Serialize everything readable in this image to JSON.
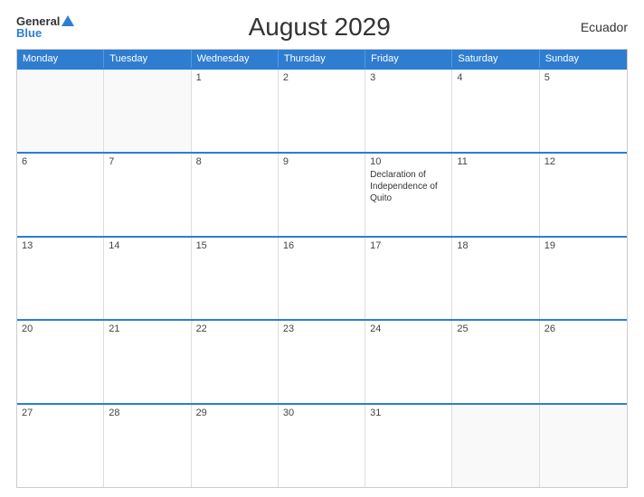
{
  "header": {
    "logo_general": "General",
    "logo_blue": "Blue",
    "title": "August 2029",
    "country": "Ecuador"
  },
  "days_of_week": [
    "Monday",
    "Tuesday",
    "Wednesday",
    "Thursday",
    "Friday",
    "Saturday",
    "Sunday"
  ],
  "weeks": [
    [
      {
        "num": "",
        "empty": true
      },
      {
        "num": "",
        "empty": true
      },
      {
        "num": "1",
        "empty": false
      },
      {
        "num": "2",
        "empty": false
      },
      {
        "num": "3",
        "empty": false
      },
      {
        "num": "4",
        "empty": false
      },
      {
        "num": "5",
        "empty": false
      }
    ],
    [
      {
        "num": "6",
        "empty": false
      },
      {
        "num": "7",
        "empty": false
      },
      {
        "num": "8",
        "empty": false
      },
      {
        "num": "9",
        "empty": false
      },
      {
        "num": "10",
        "empty": false,
        "event": "Declaration of Independence of Quito"
      },
      {
        "num": "11",
        "empty": false
      },
      {
        "num": "12",
        "empty": false
      }
    ],
    [
      {
        "num": "13",
        "empty": false
      },
      {
        "num": "14",
        "empty": false
      },
      {
        "num": "15",
        "empty": false
      },
      {
        "num": "16",
        "empty": false
      },
      {
        "num": "17",
        "empty": false
      },
      {
        "num": "18",
        "empty": false
      },
      {
        "num": "19",
        "empty": false
      }
    ],
    [
      {
        "num": "20",
        "empty": false
      },
      {
        "num": "21",
        "empty": false
      },
      {
        "num": "22",
        "empty": false
      },
      {
        "num": "23",
        "empty": false
      },
      {
        "num": "24",
        "empty": false
      },
      {
        "num": "25",
        "empty": false
      },
      {
        "num": "26",
        "empty": false
      }
    ],
    [
      {
        "num": "27",
        "empty": false
      },
      {
        "num": "28",
        "empty": false
      },
      {
        "num": "29",
        "empty": false
      },
      {
        "num": "30",
        "empty": false
      },
      {
        "num": "31",
        "empty": false
      },
      {
        "num": "",
        "empty": true
      },
      {
        "num": "",
        "empty": true
      }
    ]
  ]
}
